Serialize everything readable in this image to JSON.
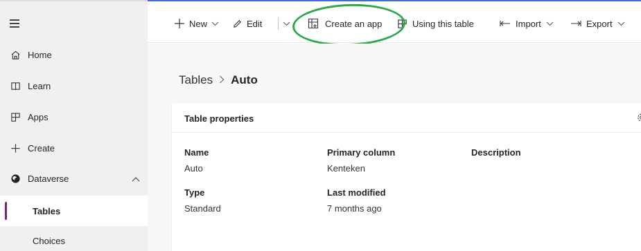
{
  "sidebar": {
    "items": [
      {
        "label": "Home",
        "icon": "home-icon"
      },
      {
        "label": "Learn",
        "icon": "book-icon"
      },
      {
        "label": "Apps",
        "icon": "apps-icon"
      },
      {
        "label": "Create",
        "icon": "plus-icon"
      },
      {
        "label": "Dataverse",
        "icon": "dataverse-icon"
      },
      {
        "label": "Tables"
      },
      {
        "label": "Choices"
      }
    ],
    "active_item": "Tables",
    "active_color": "#742774"
  },
  "toolbar": {
    "new_label": "New",
    "edit_label": "Edit",
    "create_app_label": "Create an app",
    "using_table_label": "Using this table",
    "import_label": "Import",
    "export_label": "Export",
    "highlight_color": "#2da84a"
  },
  "breadcrumb": {
    "root": "Tables",
    "current": "Auto"
  },
  "card": {
    "title": "Table properties",
    "props": {
      "name_label": "Name",
      "name_value": "Auto",
      "type_label": "Type",
      "type_value": "Standard",
      "primary_column_label": "Primary column",
      "primary_column_value": "Kenteken",
      "last_modified_label": "Last modified",
      "last_modified_value": "7 months ago",
      "description_label": "Description"
    }
  }
}
